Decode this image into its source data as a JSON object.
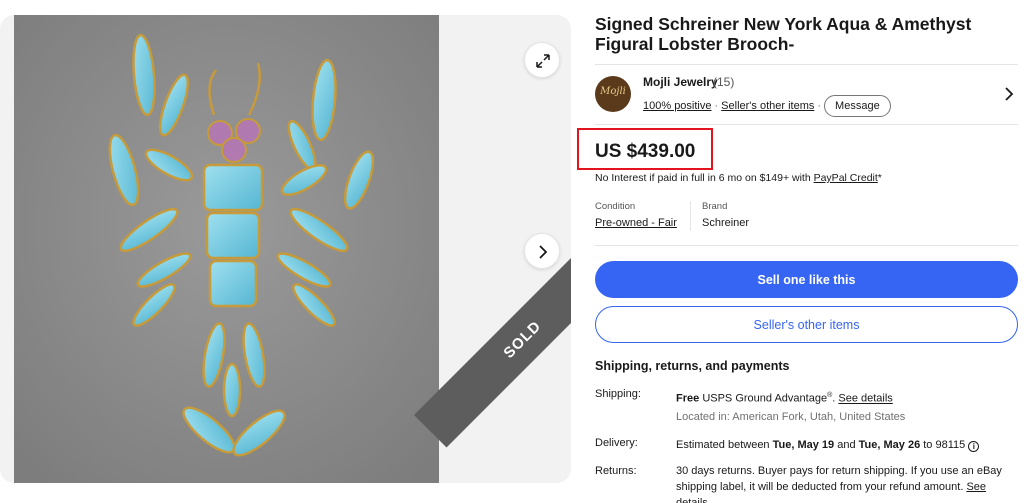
{
  "gallery": {
    "sold_label": "SOLD"
  },
  "listing": {
    "title": "Signed Schreiner New York Aqua & Amethyst Figural Lobster Brooch-"
  },
  "seller": {
    "avatar_text": "Mojli",
    "name": "Mojli Jewelry",
    "feedback_count": "(15)",
    "positive": "100% positive",
    "other_items": "Seller's other items",
    "message_label": "Message"
  },
  "price": {
    "amount": "US $439.00",
    "paypal_prefix": "No Interest if paid in full in 6 mo on $149+ with ",
    "paypal_link": "PayPal Credit",
    "paypal_suffix": "*"
  },
  "specs": {
    "condition_label": "Condition",
    "condition_value": "Pre-owned - Fair",
    "brand_label": "Brand",
    "brand_value": "Schreiner"
  },
  "actions": {
    "primary": "Sell one like this",
    "secondary": "Seller's other items"
  },
  "shipping": {
    "heading": "Shipping, returns, and payments",
    "shipping_label": "Shipping:",
    "shipping_free": "Free",
    "shipping_service": "USPS Ground Advantage",
    "shipping_reg": "®",
    "shipping_details": "See details",
    "location": "Located in: American Fork, Utah, United States",
    "delivery_label": "Delivery:",
    "delivery_prefix": "Estimated between ",
    "delivery_start": "Tue, May 19",
    "delivery_and": " and ",
    "delivery_end": "Tue, May 26",
    "delivery_suffix": " to 98115 ",
    "returns_label": "Returns:",
    "returns_text": "30 days returns. Buyer pays for return shipping. If you use an eBay shipping label, it will be deducted from your refund amount.",
    "returns_details": "See details"
  },
  "colors": {
    "accent": "#3665f3",
    "highlight_box": "#e3141e",
    "stone": "#6ec4dc",
    "amethyst": "#b07ab0",
    "gold": "#c79a3a"
  }
}
